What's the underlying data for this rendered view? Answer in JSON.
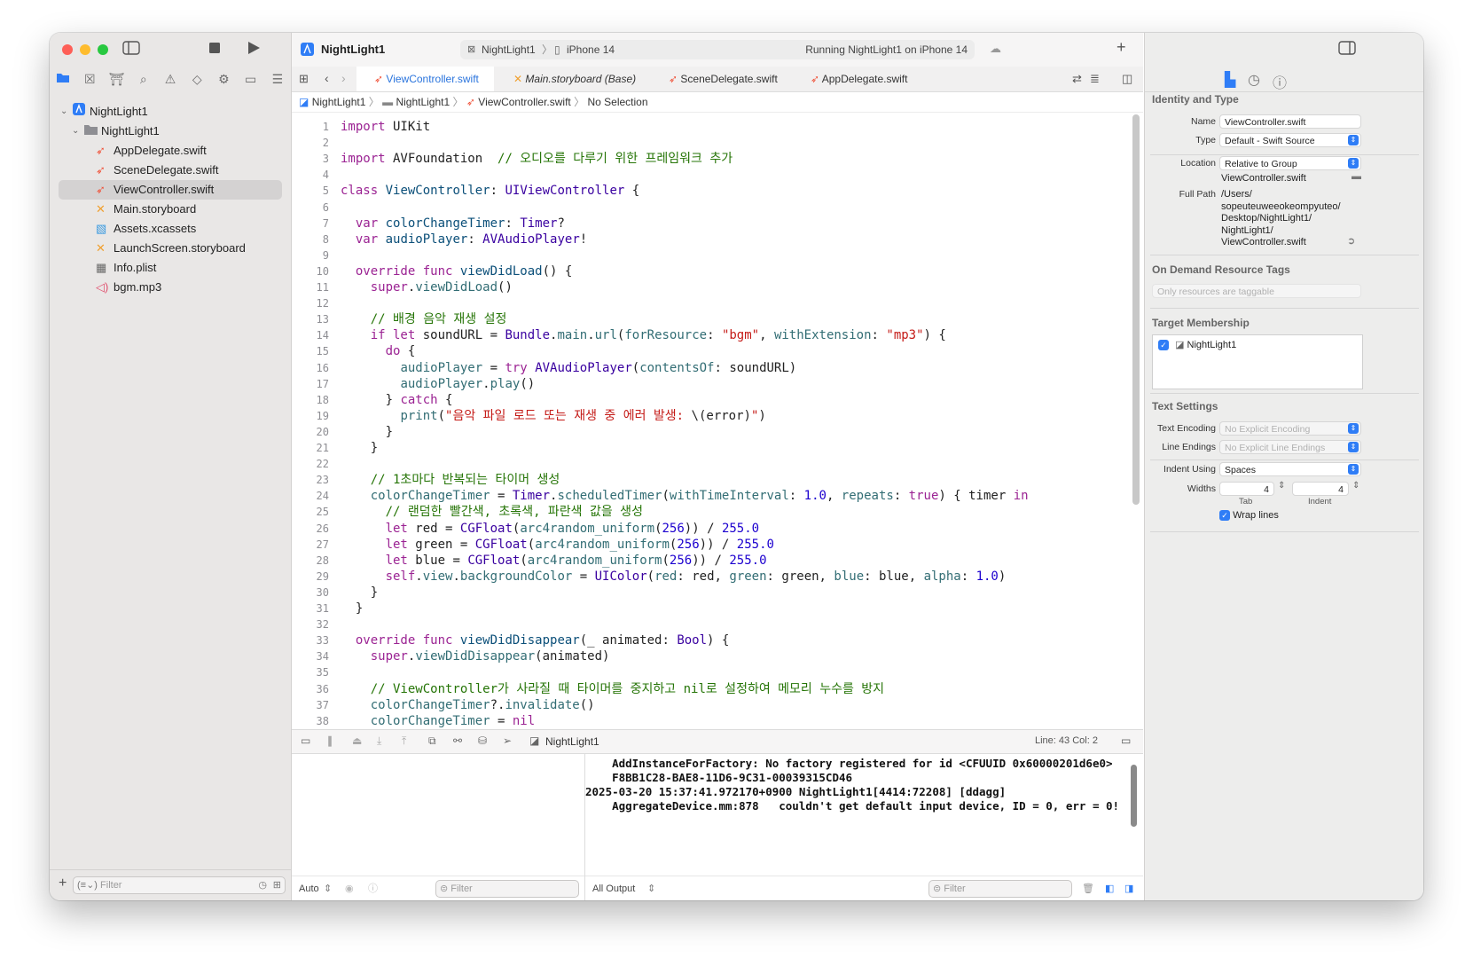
{
  "window": {
    "title": "NightLight1"
  },
  "activity": {
    "scheme": "NightLight1",
    "device": "iPhone 14",
    "status": "Running NightLight1 on iPhone 14"
  },
  "navigator": {
    "items": [
      {
        "label": "NightLight1",
        "icon": "project-icon"
      },
      {
        "label": "NightLight1",
        "icon": "folder-icon"
      },
      {
        "label": "AppDelegate.swift",
        "icon": "swift-icon"
      },
      {
        "label": "SceneDelegate.swift",
        "icon": "swift-icon"
      },
      {
        "label": "ViewController.swift",
        "icon": "swift-icon"
      },
      {
        "label": "Main.storyboard",
        "icon": "storyboard-icon"
      },
      {
        "label": "Assets.xcassets",
        "icon": "assets-icon"
      },
      {
        "label": "LaunchScreen.storyboard",
        "icon": "storyboard-icon"
      },
      {
        "label": "Info.plist",
        "icon": "plist-icon"
      },
      {
        "label": "bgm.mp3",
        "icon": "audio-icon"
      }
    ],
    "filter_placeholder": "Filter"
  },
  "tabs": [
    {
      "label": "ViewController.swift"
    },
    {
      "label": "Main.storyboard (Base)"
    },
    {
      "label": "SceneDelegate.swift"
    },
    {
      "label": "AppDelegate.swift"
    }
  ],
  "breadcrumb": [
    "NightLight1",
    "NightLight1",
    "ViewController.swift",
    "No Selection"
  ],
  "editor": {
    "lines": [
      {
        "n": "1",
        "t": [
          [
            "kw",
            "import"
          ],
          [
            "pl",
            " UIKit"
          ]
        ]
      },
      {
        "n": "2",
        "t": []
      },
      {
        "n": "3",
        "t": [
          [
            "kw",
            "import"
          ],
          [
            "pl",
            " AVFoundation  "
          ],
          [
            "cm",
            "// 오디오를 다루기 위한 프레임워크 추가"
          ]
        ]
      },
      {
        "n": "4",
        "t": []
      },
      {
        "n": "5",
        "t": [
          [
            "kw",
            "class"
          ],
          [
            "pl",
            " "
          ],
          [
            "ty",
            "ViewController"
          ],
          [
            "pl",
            ": "
          ],
          [
            "tn",
            "UIViewController"
          ],
          [
            "pl",
            " {"
          ]
        ]
      },
      {
        "n": "6",
        "t": []
      },
      {
        "n": "7",
        "t": [
          [
            "pl",
            "  "
          ],
          [
            "kw",
            "var"
          ],
          [
            "pl",
            " "
          ],
          [
            "ty",
            "colorChangeTimer"
          ],
          [
            "pl",
            ": "
          ],
          [
            "tn",
            "Timer"
          ],
          [
            "pl",
            "?"
          ]
        ]
      },
      {
        "n": "8",
        "t": [
          [
            "pl",
            "  "
          ],
          [
            "kw",
            "var"
          ],
          [
            "pl",
            " "
          ],
          [
            "ty",
            "audioPlayer"
          ],
          [
            "pl",
            ": "
          ],
          [
            "tn",
            "AVAudioPlayer"
          ],
          [
            "pl",
            "!"
          ]
        ]
      },
      {
        "n": "9",
        "t": []
      },
      {
        "n": "10",
        "t": [
          [
            "pl",
            "  "
          ],
          [
            "kw",
            "override func"
          ],
          [
            "pl",
            " "
          ],
          [
            "ty",
            "viewDidLoad"
          ],
          [
            "pl",
            "() {"
          ]
        ]
      },
      {
        "n": "11",
        "t": [
          [
            "pl",
            "    "
          ],
          [
            "kw",
            "super"
          ],
          [
            "pl",
            "."
          ],
          [
            "fn",
            "viewDidLoad"
          ],
          [
            "pl",
            "()"
          ]
        ]
      },
      {
        "n": "12",
        "t": []
      },
      {
        "n": "13",
        "t": [
          [
            "pl",
            "    "
          ],
          [
            "cm",
            "// 배경 음악 재생 설정"
          ]
        ]
      },
      {
        "n": "14",
        "t": [
          [
            "pl",
            "    "
          ],
          [
            "kw",
            "if let"
          ],
          [
            "pl",
            " soundURL = "
          ],
          [
            "tn",
            "Bundle"
          ],
          [
            "pl",
            "."
          ],
          [
            "fn",
            "main"
          ],
          [
            "pl",
            "."
          ],
          [
            "fn",
            "url"
          ],
          [
            "pl",
            "("
          ],
          [
            "fn",
            "forResource"
          ],
          [
            "pl",
            ": "
          ],
          [
            "st",
            "\"bgm\""
          ],
          [
            "pl",
            ", "
          ],
          [
            "fn",
            "withExtension"
          ],
          [
            "pl",
            ": "
          ],
          [
            "st",
            "\"mp3\""
          ],
          [
            "pl",
            ") {"
          ]
        ]
      },
      {
        "n": "15",
        "t": [
          [
            "pl",
            "      "
          ],
          [
            "kw",
            "do"
          ],
          [
            "pl",
            " {"
          ]
        ]
      },
      {
        "n": "16",
        "t": [
          [
            "pl",
            "        "
          ],
          [
            "fn",
            "audioPlayer"
          ],
          [
            "pl",
            " = "
          ],
          [
            "kw",
            "try"
          ],
          [
            "pl",
            " "
          ],
          [
            "tn",
            "AVAudioPlayer"
          ],
          [
            "pl",
            "("
          ],
          [
            "fn",
            "contentsOf"
          ],
          [
            "pl",
            ": soundURL)"
          ]
        ]
      },
      {
        "n": "17",
        "t": [
          [
            "pl",
            "        "
          ],
          [
            "fn",
            "audioPlayer"
          ],
          [
            "pl",
            "."
          ],
          [
            "fn",
            "play"
          ],
          [
            "pl",
            "()"
          ]
        ]
      },
      {
        "n": "18",
        "t": [
          [
            "pl",
            "      } "
          ],
          [
            "kw",
            "catch"
          ],
          [
            "pl",
            " {"
          ]
        ]
      },
      {
        "n": "19",
        "t": [
          [
            "pl",
            "        "
          ],
          [
            "fn",
            "print"
          ],
          [
            "pl",
            "("
          ],
          [
            "st",
            "\"음악 파일 로드 또는 재생 중 에러 발생: "
          ],
          [
            "pl",
            "\\(error)"
          ],
          [
            "st",
            "\""
          ],
          [
            "pl",
            ")"
          ]
        ]
      },
      {
        "n": "20",
        "t": [
          [
            "pl",
            "      }"
          ]
        ]
      },
      {
        "n": "21",
        "t": [
          [
            "pl",
            "    }"
          ]
        ]
      },
      {
        "n": "22",
        "t": []
      },
      {
        "n": "23",
        "t": [
          [
            "pl",
            "    "
          ],
          [
            "cm",
            "// 1초마다 반복되는 타이머 생성"
          ]
        ]
      },
      {
        "n": "24",
        "t": [
          [
            "pl",
            "    "
          ],
          [
            "fn",
            "colorChangeTimer"
          ],
          [
            "pl",
            " = "
          ],
          [
            "tn",
            "Timer"
          ],
          [
            "pl",
            "."
          ],
          [
            "fn",
            "scheduledTimer"
          ],
          [
            "pl",
            "("
          ],
          [
            "fn",
            "withTimeInterval"
          ],
          [
            "pl",
            ": "
          ],
          [
            "nm",
            "1.0"
          ],
          [
            "pl",
            ", "
          ],
          [
            "fn",
            "repeats"
          ],
          [
            "pl",
            ": "
          ],
          [
            "kw",
            "true"
          ],
          [
            "pl",
            ") { timer "
          ],
          [
            "kw",
            "in"
          ]
        ]
      },
      {
        "n": "25",
        "t": [
          [
            "pl",
            "      "
          ],
          [
            "cm",
            "// 랜덤한 빨간색, 초록색, 파란색 값을 생성"
          ]
        ]
      },
      {
        "n": "26",
        "t": [
          [
            "pl",
            "      "
          ],
          [
            "kw",
            "let"
          ],
          [
            "pl",
            " red = "
          ],
          [
            "tn",
            "CGFloat"
          ],
          [
            "pl",
            "("
          ],
          [
            "fn",
            "arc4random_uniform"
          ],
          [
            "pl",
            "("
          ],
          [
            "nm",
            "256"
          ],
          [
            "pl",
            ")) / "
          ],
          [
            "nm",
            "255.0"
          ]
        ]
      },
      {
        "n": "27",
        "t": [
          [
            "pl",
            "      "
          ],
          [
            "kw",
            "let"
          ],
          [
            "pl",
            " green = "
          ],
          [
            "tn",
            "CGFloat"
          ],
          [
            "pl",
            "("
          ],
          [
            "fn",
            "arc4random_uniform"
          ],
          [
            "pl",
            "("
          ],
          [
            "nm",
            "256"
          ],
          [
            "pl",
            ")) / "
          ],
          [
            "nm",
            "255.0"
          ]
        ]
      },
      {
        "n": "28",
        "t": [
          [
            "pl",
            "      "
          ],
          [
            "kw",
            "let"
          ],
          [
            "pl",
            " blue = "
          ],
          [
            "tn",
            "CGFloat"
          ],
          [
            "pl",
            "("
          ],
          [
            "fn",
            "arc4random_uniform"
          ],
          [
            "pl",
            "("
          ],
          [
            "nm",
            "256"
          ],
          [
            "pl",
            ")) / "
          ],
          [
            "nm",
            "255.0"
          ]
        ]
      },
      {
        "n": "29",
        "t": [
          [
            "pl",
            "      "
          ],
          [
            "kw",
            "self"
          ],
          [
            "pl",
            "."
          ],
          [
            "fn",
            "view"
          ],
          [
            "pl",
            "."
          ],
          [
            "fn",
            "backgroundColor"
          ],
          [
            "pl",
            " = "
          ],
          [
            "tn",
            "UIColor"
          ],
          [
            "pl",
            "("
          ],
          [
            "fn",
            "red"
          ],
          [
            "pl",
            ": red, "
          ],
          [
            "fn",
            "green"
          ],
          [
            "pl",
            ": green, "
          ],
          [
            "fn",
            "blue"
          ],
          [
            "pl",
            ": blue, "
          ],
          [
            "fn",
            "alpha"
          ],
          [
            "pl",
            ": "
          ],
          [
            "nm",
            "1.0"
          ],
          [
            "pl",
            ")"
          ]
        ]
      },
      {
        "n": "30",
        "t": [
          [
            "pl",
            "    }"
          ]
        ]
      },
      {
        "n": "31",
        "t": [
          [
            "pl",
            "  }"
          ]
        ]
      },
      {
        "n": "32",
        "t": []
      },
      {
        "n": "33",
        "t": [
          [
            "pl",
            "  "
          ],
          [
            "kw",
            "override func"
          ],
          [
            "pl",
            " "
          ],
          [
            "ty",
            "viewDidDisappear"
          ],
          [
            "pl",
            "(_ animated: "
          ],
          [
            "tn",
            "Bool"
          ],
          [
            "pl",
            ") {"
          ]
        ]
      },
      {
        "n": "34",
        "t": [
          [
            "pl",
            "    "
          ],
          [
            "kw",
            "super"
          ],
          [
            "pl",
            "."
          ],
          [
            "fn",
            "viewDidDisappear"
          ],
          [
            "pl",
            "(animated)"
          ]
        ]
      },
      {
        "n": "35",
        "t": []
      },
      {
        "n": "36",
        "t": [
          [
            "pl",
            "    "
          ],
          [
            "cm",
            "// ViewController가 사라질 때 타이머를 중지하고 nil로 설정하여 메모리 누수를 방지"
          ]
        ]
      },
      {
        "n": "37",
        "t": [
          [
            "pl",
            "    "
          ],
          [
            "fn",
            "colorChangeTimer"
          ],
          [
            "pl",
            "?."
          ],
          [
            "fn",
            "invalidate"
          ],
          [
            "pl",
            "()"
          ]
        ]
      },
      {
        "n": "38",
        "t": [
          [
            "pl",
            "    "
          ],
          [
            "fn",
            "colorChangeTimer"
          ],
          [
            "pl",
            " = "
          ],
          [
            "kw",
            "nil"
          ]
        ]
      }
    ]
  },
  "debug": {
    "target": "NightLight1",
    "cursor": "Line: 43  Col: 2"
  },
  "console": {
    "lines": [
      "    AddInstanceForFactory: No factory registered for id <CFUUID 0x60000201d6e0>",
      "    F8BB1C28-BAE8-11D6-9C31-00039315CD46",
      "2025-03-20 15:37:41.972170+0900 NightLight1[4414:72208] [ddagg]",
      "    AggregateDevice.mm:878   couldn't get default input device, ID = 0, err = 0!"
    ],
    "filter_placeholder": "Filter",
    "scope": "All Output",
    "var_scope": "Auto",
    "var_filter_placeholder": "Filter"
  },
  "inspector": {
    "identity_title": "Identity and Type",
    "name_label": "Name",
    "name_value": "ViewController.swift",
    "type_label": "Type",
    "type_value": "Default - Swift Source",
    "location_label": "Location",
    "location_value": "Relative to Group",
    "location_file": "ViewController.swift",
    "fullpath_label": "Full Path",
    "fullpath_lines": [
      "/Users/",
      "sopeuteuweeokeompyuteo/",
      "Desktop/NightLight1/",
      "NightLight1/",
      "ViewController.swift"
    ],
    "odr_title": "On Demand Resource Tags",
    "odr_placeholder": "Only resources are taggable",
    "target_title": "Target Membership",
    "target_item": "NightLight1",
    "text_title": "Text Settings",
    "encoding_label": "Text Encoding",
    "encoding_value": "No Explicit Encoding",
    "endings_label": "Line Endings",
    "endings_value": "No Explicit Line Endings",
    "indent_label": "Indent Using",
    "indent_value": "Spaces",
    "widths_label": "Widths",
    "tab_width": "4",
    "indent_width": "4",
    "tab_caption": "Tab",
    "indent_caption": "Indent",
    "wrap_label": "Wrap lines"
  },
  "colors": {
    "accent": "#2f7df6",
    "close": "#fe5f57",
    "minimize": "#febc2e",
    "zoom": "#28c840"
  }
}
